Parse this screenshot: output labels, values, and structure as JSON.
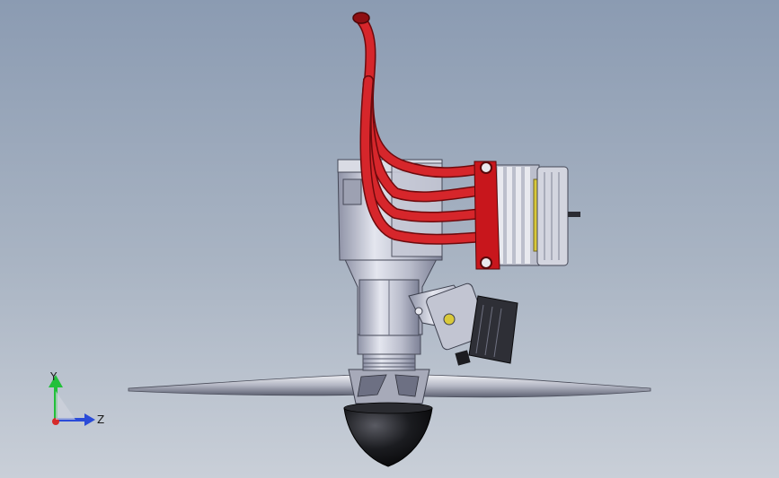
{
  "viewport": {
    "background_top": "#8b9bb2",
    "background_bottom": "#c9cfd8"
  },
  "model": {
    "exhaust_color": "#c8161c",
    "body_color": "#bfc3d2",
    "blade_color": "#d4d6de",
    "spinner_color": "#141416",
    "fin_color": "#cfd1db",
    "accent_color": "#d9c93a"
  },
  "triad": {
    "y_label": "Y",
    "z_label": "Z",
    "y_color": "#22c03a",
    "z_color": "#2a4bd8",
    "x_color": "#d62a2a"
  }
}
